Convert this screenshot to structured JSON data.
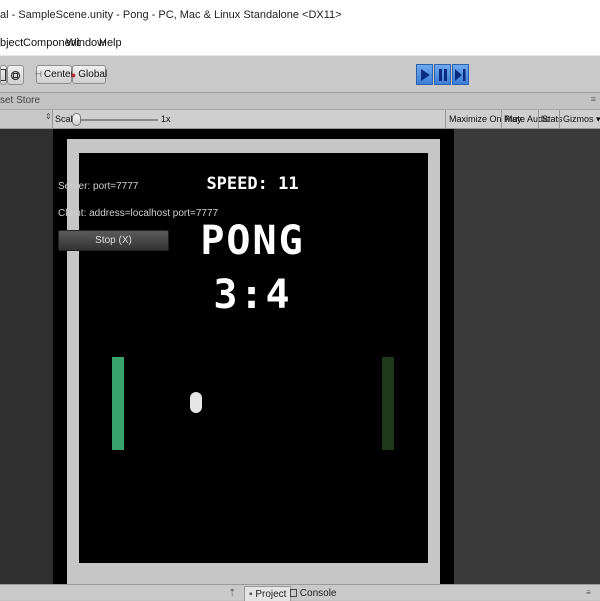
{
  "window": {
    "title": "al - SampleScene.unity - Pong - PC, Mac & Linux Standalone <DX11>"
  },
  "menu": {
    "items": [
      "bject",
      "Component",
      "Window",
      "Help"
    ]
  },
  "toolbar": {
    "pivot_label": "Center",
    "space_label": "Global",
    "play_icon": "play-icon",
    "pause_icon": "pause-icon",
    "step_icon": "step-icon"
  },
  "store_bar": {
    "tab_label": "set Store",
    "menu_glyph": "≡"
  },
  "game_bar": {
    "scale_label": "Scale",
    "scale_value": "1x",
    "maximize_label": "Maximize On Play",
    "mute_label": "Mute Audio",
    "stats_label": "Stats",
    "gizmos_label": "Gizmos ▾"
  },
  "hud": {
    "server_text": "Server: port=7777",
    "client_text": "Client: address=localhost port=7777",
    "stop_label": "Stop (X)"
  },
  "game": {
    "speed_text": "SPEED: 11",
    "title": "PONG",
    "score": "3:4",
    "left_paddle_color": "#3aa36b",
    "right_paddle_color": "#1e3a18",
    "ball_color": "#e6e6e6"
  },
  "bottom_bar": {
    "project_label": "Project",
    "console_label": "Console"
  }
}
